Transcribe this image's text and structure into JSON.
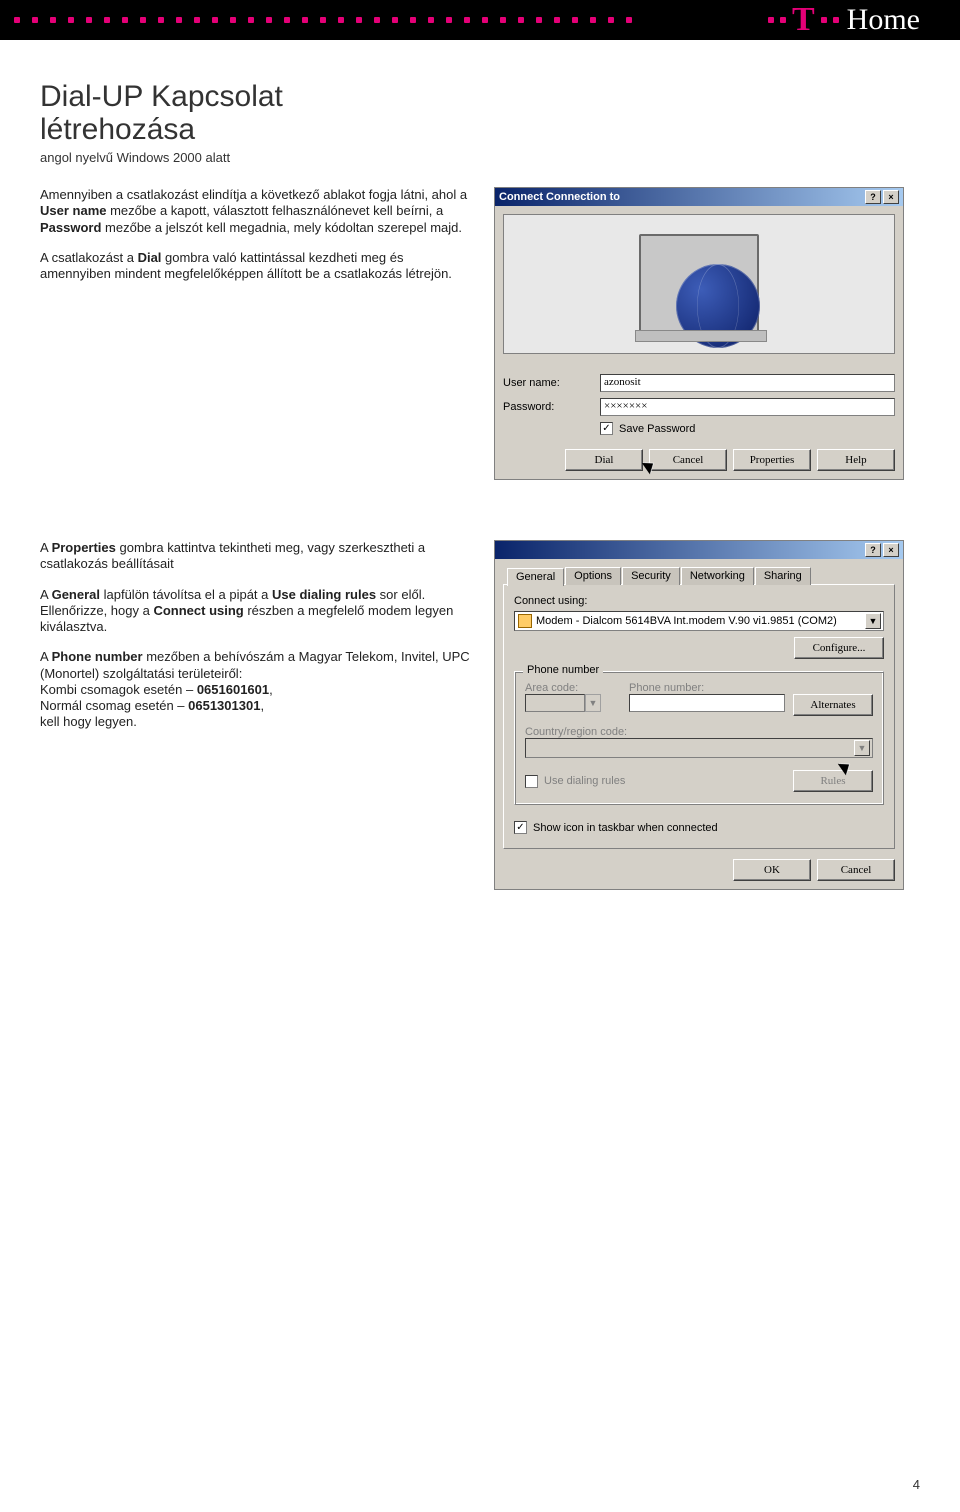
{
  "brand": {
    "home_word": "Home"
  },
  "doc": {
    "title_line1": "Dial-UP Kapcsolat",
    "title_line2": "létrehozása",
    "subtitle": "angol nyelvű Windows 2000 alatt",
    "page_number": "4"
  },
  "para1": {
    "t1": "Amennyiben a csatlakozást elindítja a következő ablakot fogja látni, ahol a ",
    "b1": "User name",
    "t2": " mezőbe a kapott, választott felhasználónevet kell beírni, a ",
    "b2": "Password",
    "t3": " mezőbe a jelszót kell megadnia, mely kódoltan szerepel majd."
  },
  "para2": {
    "t1": "A csatlakozást a ",
    "b1": "Dial",
    "t2": " gombra való kattintással kezdheti meg és amennyiben mindent megfelelőképpen állított be a csatlakozás létrejön."
  },
  "para3": {
    "t1": "A ",
    "b1": "Properties",
    "t2": " gombra kattintva tekintheti meg, vagy szerkesztheti a csatlakozás beállításait"
  },
  "para4": {
    "t1": "A ",
    "b1": "General",
    "t2": " lapfülön távolítsa el a pipát a ",
    "b2": "Use dialing rules",
    "t3": " sor elől. Ellenőrizze, hogy a ",
    "b3": "Connect using",
    "t4": " részben a megfelelő modem legyen kiválasztva."
  },
  "para5": {
    "t1": "A ",
    "b1": "Phone number",
    "t2": " mezőben a behívószám a Magyar Telekom, Invitel, UPC (Monortel) szolgáltatási területeiről:",
    "line2a": "Kombi csomagok esetén – ",
    "num1": "0651601601",
    "comma1": ",",
    "line3a": "Normál csomag esetén – ",
    "num2": "0651301301",
    "comma2": ",",
    "line4": "kell hogy legyen."
  },
  "dlg1": {
    "title": "Connect Connection to",
    "username_label": "User name:",
    "username_value": "azonosit",
    "password_label": "Password:",
    "password_value": "×××××××",
    "save_password": "Save Password",
    "btn_dial": "Dial",
    "btn_cancel": "Cancel",
    "btn_properties": "Properties",
    "btn_help": "Help"
  },
  "dlg2": {
    "tabs": {
      "general": "General",
      "options": "Options",
      "security": "Security",
      "networking": "Networking",
      "sharing": "Sharing"
    },
    "connect_using_label": "Connect using:",
    "connect_using_value": "Modem - Dialcom 5614BVA Int.modem V.90 vi1.9851 (COM2)",
    "configure": "Configure...",
    "group_phone": "Phone number",
    "area_code": "Area code:",
    "phone_number": "Phone number:",
    "alternates": "Alternates",
    "country_region": "Country/region code:",
    "use_dialing_rules": "Use dialing rules",
    "rules": "Rules",
    "show_icon": "Show icon in taskbar when connected",
    "ok": "OK",
    "cancel": "Cancel"
  }
}
